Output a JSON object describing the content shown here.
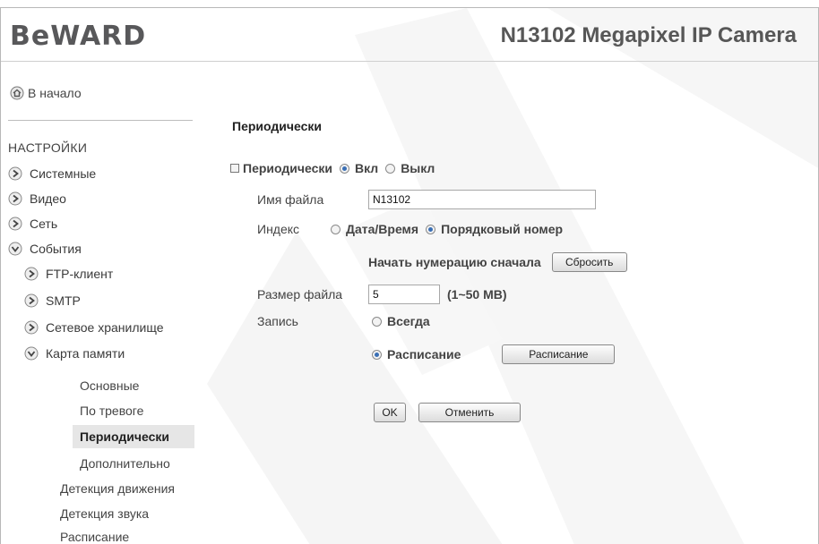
{
  "header": {
    "logo": "BeWARD",
    "product": "N13102 Megapixel IP Camera"
  },
  "sidebar": {
    "home": "В начало",
    "heading": "НАСТРОЙКИ",
    "items": [
      {
        "label": "Системные",
        "icon": "arrow-right-icon"
      },
      {
        "label": "Видео",
        "icon": "arrow-right-icon"
      },
      {
        "label": "Сеть",
        "icon": "arrow-right-icon"
      },
      {
        "label": "События",
        "icon": "arrow-down-icon"
      },
      {
        "label": "FTP-клиент",
        "icon": "arrow-right-icon"
      },
      {
        "label": "SMTP",
        "icon": "arrow-right-icon"
      },
      {
        "label": "Сетевое хранилище",
        "icon": "arrow-right-icon"
      },
      {
        "label": "Карта памяти",
        "icon": "arrow-down-icon"
      },
      {
        "label": "Основные"
      },
      {
        "label": "По тревоге"
      },
      {
        "label": "Периодически",
        "selected": true
      },
      {
        "label": "Дополнительно"
      },
      {
        "label": "Детекция движения"
      },
      {
        "label": "Детекция звука"
      },
      {
        "label": "Расписание"
      }
    ]
  },
  "main": {
    "title": "Периодически",
    "periodic": {
      "label": "Периодически",
      "on": "Вкл",
      "off": "Выкл",
      "selected": "on"
    },
    "filename": {
      "label": "Имя файла",
      "value": "N13102"
    },
    "index": {
      "label": "Индекс",
      "opt1": "Дата/Время",
      "opt2": "Порядковый номер",
      "selected": "opt2"
    },
    "reset": {
      "label": "Начать нумерацию сначала",
      "button": "Сбросить"
    },
    "filesize": {
      "label": "Размер файла",
      "value": "5",
      "hint": "(1~50 MB)"
    },
    "record": {
      "label": "Запись",
      "opt1": "Всегда",
      "opt2": "Расписание",
      "selected": "opt2",
      "button": "Расписание"
    },
    "ok": "OK",
    "cancel": "Отменить"
  },
  "colors": {
    "accent": "#3a6fb5",
    "selected_bg": "#e6e6e6"
  }
}
